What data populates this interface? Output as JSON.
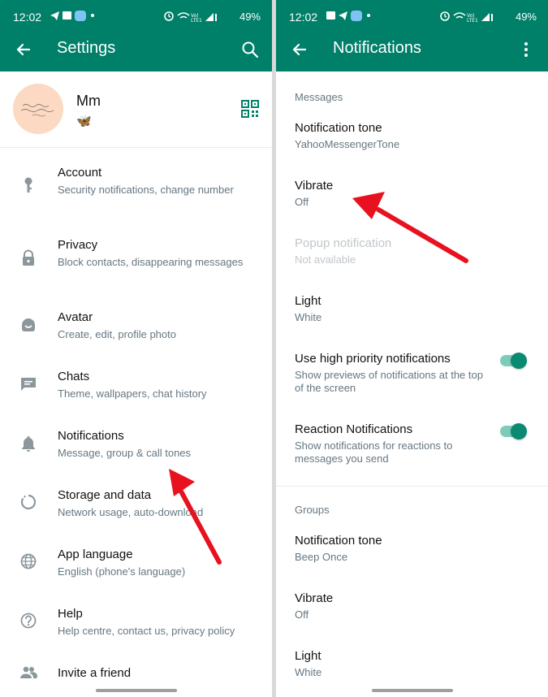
{
  "status_bar": {
    "time": "12:02",
    "battery": "49%",
    "notification_badge": "NE"
  },
  "left": {
    "title": "Settings",
    "profile": {
      "name": "Mm",
      "about": "🦋"
    },
    "items": [
      {
        "title": "Account",
        "subtitle": "Security notifications, change number",
        "icon": "key-icon"
      },
      {
        "title": "Privacy",
        "subtitle": "Block contacts, disappearing messages",
        "icon": "lock-icon"
      },
      {
        "title": "Avatar",
        "subtitle": "Create, edit, profile photo",
        "icon": "avatar-face-icon"
      },
      {
        "title": "Chats",
        "subtitle": "Theme, wallpapers, chat history",
        "icon": "chat-icon"
      },
      {
        "title": "Notifications",
        "subtitle": "Message, group & call tones",
        "icon": "bell-icon"
      },
      {
        "title": "Storage and data",
        "subtitle": "Network usage, auto-download",
        "icon": "storage-icon"
      },
      {
        "title": "App language",
        "subtitle": "English (phone's language)",
        "icon": "globe-icon"
      },
      {
        "title": "Help",
        "subtitle": "Help centre, contact us, privacy policy",
        "icon": "help-icon"
      },
      {
        "title": "Invite a friend",
        "subtitle": "",
        "icon": "people-icon"
      }
    ]
  },
  "right": {
    "title": "Notifications",
    "messages_section": {
      "label": "Messages",
      "items": [
        {
          "title": "Notification tone",
          "subtitle": "YahooMessengerTone"
        },
        {
          "title": "Vibrate",
          "subtitle": "Off"
        },
        {
          "title": "Popup notification",
          "subtitle": "Not available",
          "disabled": true
        },
        {
          "title": "Light",
          "subtitle": "White"
        },
        {
          "title": "Use high priority notifications",
          "subtitle": "Show previews of notifications at the top of the screen",
          "toggle": true
        },
        {
          "title": "Reaction Notifications",
          "subtitle": "Show notifications for reactions to messages you send",
          "toggle": true
        }
      ]
    },
    "groups_section": {
      "label": "Groups",
      "items": [
        {
          "title": "Notification tone",
          "subtitle": "Beep Once"
        },
        {
          "title": "Vibrate",
          "subtitle": "Off"
        },
        {
          "title": "Light",
          "subtitle": "White"
        }
      ]
    }
  },
  "colors": {
    "header": "#008069",
    "toggle_on": "#0a8a71",
    "annotation_arrow": "#e8111f"
  }
}
